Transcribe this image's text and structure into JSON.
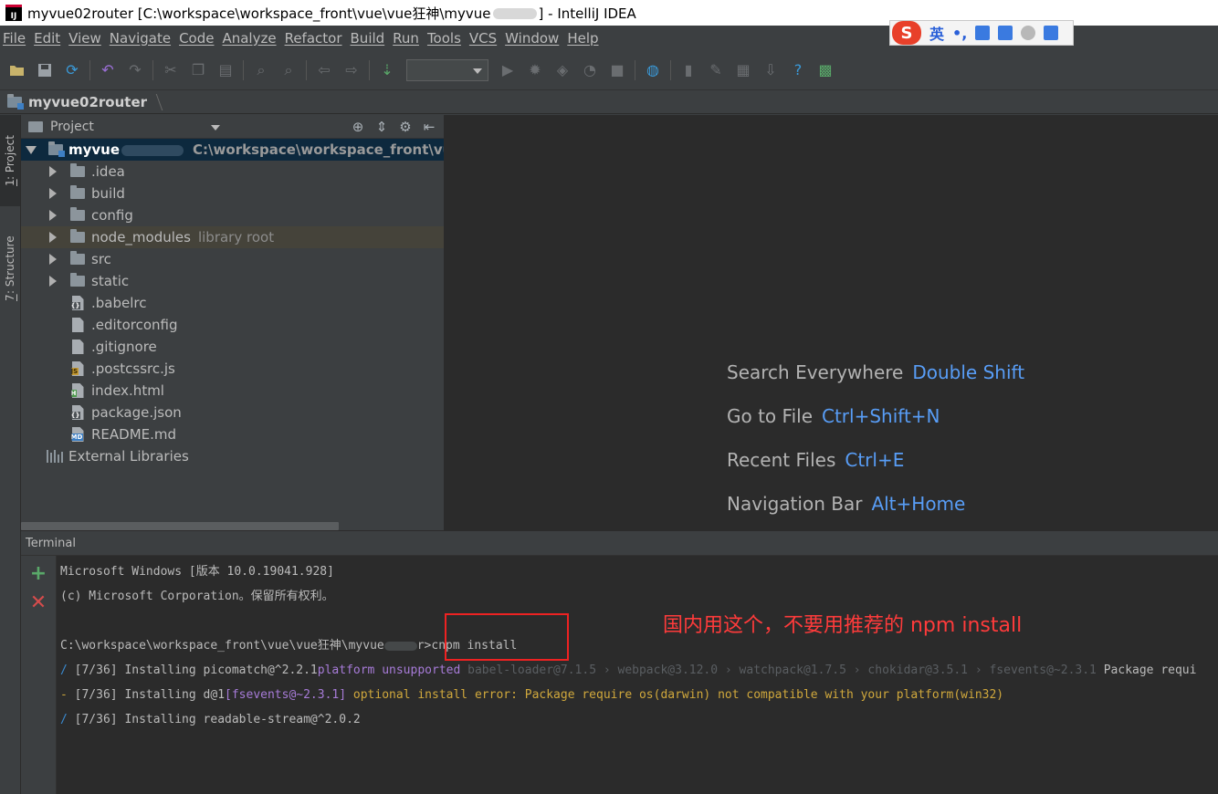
{
  "window": {
    "title_prefix": "myvue02router [C:\\workspace\\workspace_front\\vue\\vue狂神\\myvue",
    "title_suffix": "] - IntelliJ IDEA",
    "app_icon_label": "IJ"
  },
  "menu": [
    "File",
    "Edit",
    "View",
    "Navigate",
    "Code",
    "Analyze",
    "Refactor",
    "Build",
    "Run",
    "Tools",
    "VCS",
    "Window",
    "Help"
  ],
  "ime": {
    "logo": "S",
    "mode": "英",
    "punct": "•,"
  },
  "navbar": {
    "crumb": "myvue02router"
  },
  "left_strip": {
    "project_tab_num": "1",
    "project_tab": ": Project",
    "structure_tab_num": "7",
    "structure_tab": ": Structure"
  },
  "project_panel": {
    "title": "Project",
    "root": {
      "name": "myvue",
      "path": "C:\\workspace\\workspace_front\\vue\\vue"
    },
    "items": [
      {
        "name": ".idea",
        "type": "folder"
      },
      {
        "name": "build",
        "type": "folder"
      },
      {
        "name": "config",
        "type": "folder"
      },
      {
        "name": "node_modules",
        "type": "folder",
        "hint": "library root"
      },
      {
        "name": "src",
        "type": "folder"
      },
      {
        "name": "static",
        "type": "folder"
      },
      {
        "name": ".babelrc",
        "type": "file",
        "tag": "{}"
      },
      {
        "name": ".editorconfig",
        "type": "file"
      },
      {
        "name": ".gitignore",
        "type": "file"
      },
      {
        "name": ".postcssrc.js",
        "type": "file",
        "tag": "JS"
      },
      {
        "name": "index.html",
        "type": "file",
        "tag": "H"
      },
      {
        "name": "package.json",
        "type": "file",
        "tag": "{}"
      },
      {
        "name": "README.md",
        "type": "file",
        "tag": "MD"
      }
    ],
    "external_libraries": "External Libraries"
  },
  "editor_hints": [
    {
      "label": "Search Everywhere",
      "shortcut": "Double Shift"
    },
    {
      "label": "Go to File",
      "shortcut": "Ctrl+Shift+N"
    },
    {
      "label": "Recent Files",
      "shortcut": "Ctrl+E"
    },
    {
      "label": "Navigation Bar",
      "shortcut": "Alt+Home"
    }
  ],
  "terminal": {
    "title": "Terminal",
    "line1": "Microsoft Windows [版本 10.0.19041.928]",
    "line2": "(c) Microsoft Corporation。保留所有权利。",
    "prompt_prefix": "C:\\workspace\\workspace_front\\vue\\vue狂神\\myvue",
    "prompt_suffix": "r>",
    "command": "cnpm install",
    "install1": {
      "spin": "/",
      "text": " [7/36] Installing picomatch@^2.2.1",
      "warn": "platform unsupported",
      "dep": " babel-loader@7.1.5 › webpack@3.12.0 › watchpack@1.7.5 › chokidar@3.5.1 › fsevents@~2.3.1",
      "tail": " Package requi"
    },
    "install2": {
      "spin": "-",
      "text": " [7/36] Installing d@1",
      "pkg": "[fsevents@~2.3.1]",
      "error": " optional install error: Package require os(darwin) not compatible with your platform(win32)"
    },
    "install3": {
      "spin": "/",
      "text": " [7/36] Installing readable-stream@^2.0.2"
    },
    "annotation": "国内用这个，不要用推荐的 npm install"
  }
}
